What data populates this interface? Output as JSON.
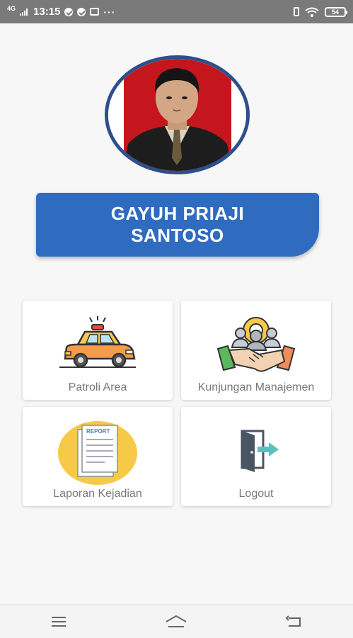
{
  "status_bar": {
    "network": "4G",
    "time": "13:15",
    "more": "···",
    "battery": "54"
  },
  "profile": {
    "name": "GAYUH PRIAJI SANTOSO"
  },
  "menu": [
    {
      "label": "Patroli Area",
      "icon": "taxi-car-icon"
    },
    {
      "label": "Kunjungan Manajemen",
      "icon": "handshake-team-icon"
    },
    {
      "label": "Laporan Kejadian",
      "icon": "report-document-icon"
    },
    {
      "label": "Logout",
      "icon": "logout-door-icon"
    }
  ],
  "report_icon_text": "REPORT",
  "colors": {
    "banner": "#2f6cc0",
    "avatar_border": "#2d4f8c",
    "status_bar": "#7a7a7a",
    "label_text": "#777777"
  }
}
